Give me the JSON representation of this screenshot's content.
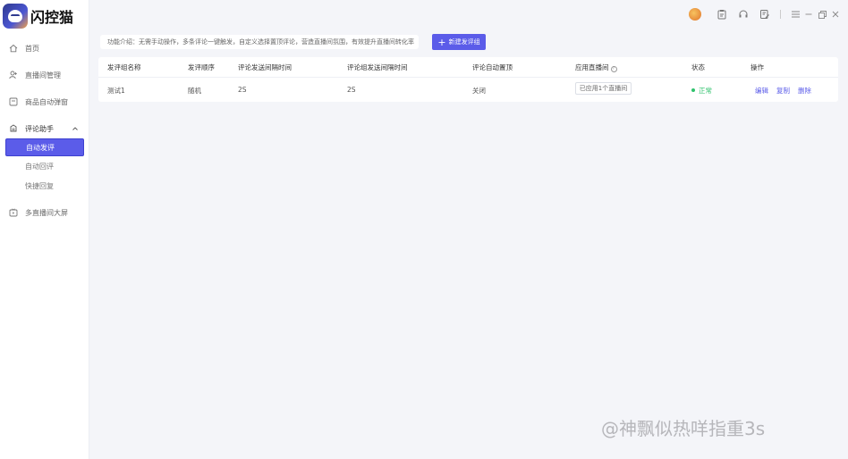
{
  "app": {
    "logo_text": "闪控猫"
  },
  "sidebar": {
    "items": [
      {
        "label": "首页",
        "icon": "home-icon"
      },
      {
        "label": "直播间管理",
        "icon": "user-icon"
      },
      {
        "label": "商品自动弹窗",
        "icon": "window-icon"
      },
      {
        "label": "评论助手",
        "icon": "comment-icon"
      },
      {
        "label": "多直播间大屏",
        "icon": "tv-icon"
      }
    ],
    "sub_items": [
      {
        "label": "自动发评",
        "active": true
      },
      {
        "label": "自动回评",
        "active": false
      },
      {
        "label": "快捷回复",
        "active": false
      }
    ]
  },
  "main": {
    "intro": "功能介绍：无需手动操作，多条评论一键触发，自定义选择置顶评论，营造直播间氛围，有效提升直播间转化率",
    "new_button": "新建发评组",
    "table": {
      "headers": {
        "name": "发评组名称",
        "order": "发评顺序",
        "interval1": "评论发送间隔时间",
        "interval2": "评论组发送间隔时间",
        "pin": "评论自动置顶",
        "room": "应用直播间",
        "status": "状态",
        "ops": "操作"
      },
      "rows": [
        {
          "name": "测试1",
          "order": "随机",
          "interval1": "2S",
          "interval2": "2S",
          "pin": "关闭",
          "room": "已应用1个直播间",
          "status": "正常",
          "ops": {
            "edit": "编辑",
            "copy": "复制",
            "delete": "删除"
          }
        }
      ]
    }
  },
  "watermark": "@神飘似热咩指重3s",
  "colors": {
    "accent": "#5b5ce9",
    "status_ok": "#2fc26c"
  }
}
